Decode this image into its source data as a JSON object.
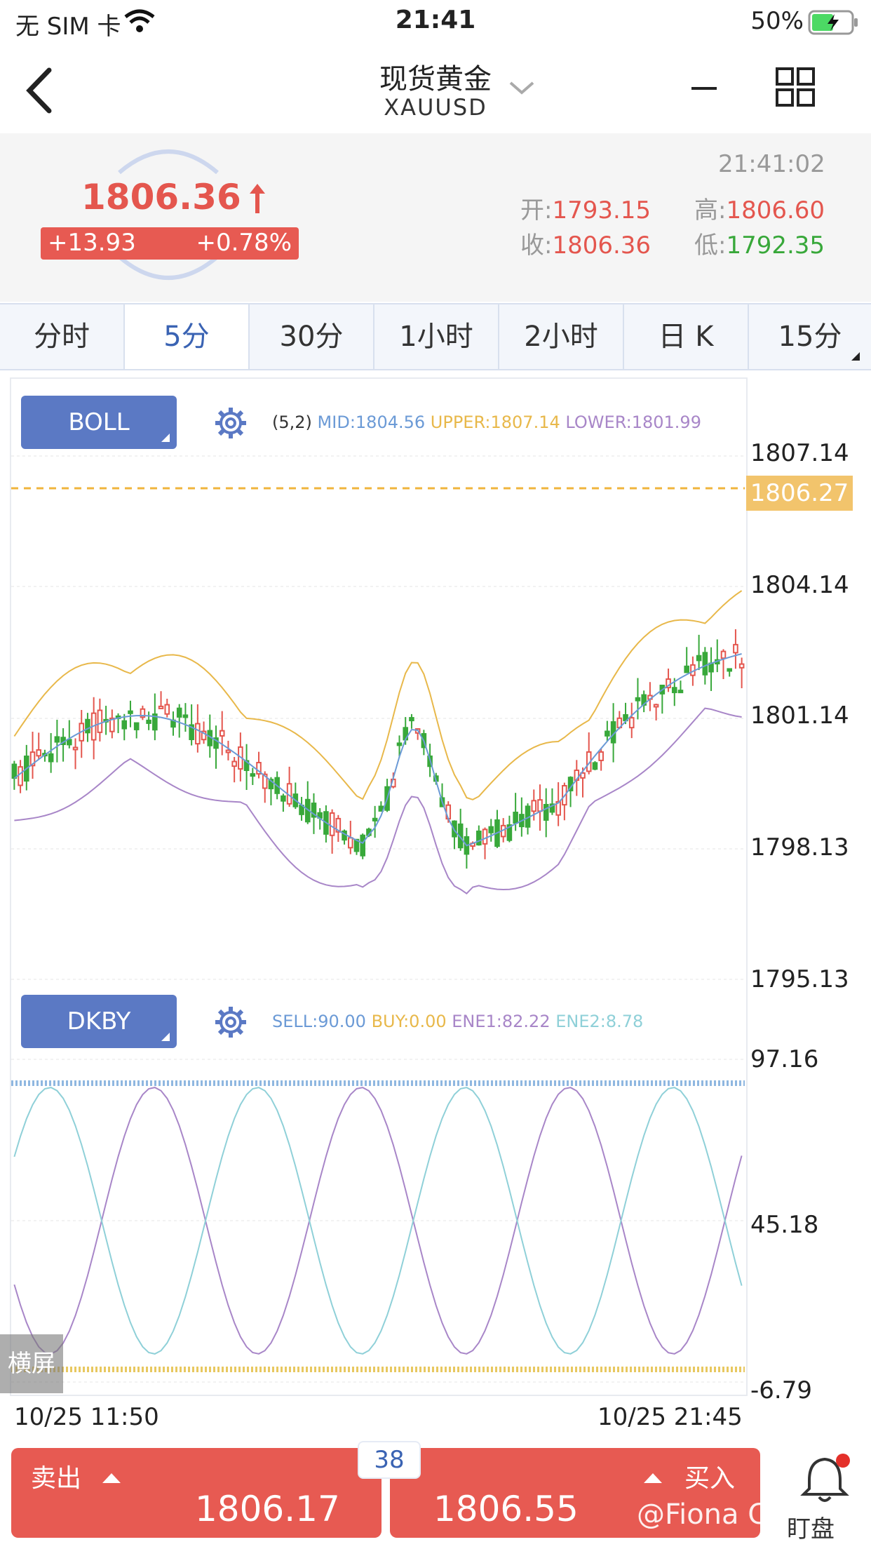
{
  "status": {
    "carrier": "无 SIM 卡",
    "time": "21:41",
    "battery": "50%"
  },
  "nav": {
    "title": "现货黄金",
    "symbol": "XAUUSD"
  },
  "quote": {
    "price": "1806.36",
    "change": "+13.93",
    "change_pct": "+0.78%",
    "timestamp": "21:41:02",
    "open_label": "开:",
    "open": "1793.15",
    "high_label": "高:",
    "high": "1806.60",
    "close_label": "收:",
    "close": "1806.36",
    "low_label": "低:",
    "low": "1792.35"
  },
  "tabs": [
    {
      "label": "分时"
    },
    {
      "label": "5分"
    },
    {
      "label": "30分"
    },
    {
      "label": "1小时"
    },
    {
      "label": "2小时"
    },
    {
      "label": "日 K"
    },
    {
      "label": "15分"
    }
  ],
  "boll": {
    "button": "BOLL",
    "params": "(5,2)",
    "mid": "MID:1804.56",
    "upper": "UPPER:1807.14",
    "lower": "LOWER:1801.99",
    "yticks": [
      "1807.14",
      "1804.14",
      "1801.14",
      "1798.13",
      "1795.13"
    ],
    "current": "1806.27"
  },
  "dkby": {
    "button": "DKBY",
    "sell": "SELL:90.00",
    "buy": "BUY:0.00",
    "ene1": "ENE1:82.22",
    "ene2": "ENE2:8.78",
    "yticks": [
      "97.16",
      "45.18",
      "-6.79"
    ]
  },
  "dates": {
    "start": "10/25 11:50",
    "end": "10/25 21:45"
  },
  "hscreen": "横屏",
  "trade": {
    "sell_label": "卖出",
    "sell_price": "1806.17",
    "buy_label": "买入",
    "buy_price": "1806.55",
    "spread": "38",
    "alert_label": "盯盘",
    "watermark": "@Fiona Chan"
  },
  "colors": {
    "up": "#e4564e",
    "down": "#38a83a",
    "accent": "#5b79c4",
    "upper": "#e8b84a",
    "lower": "#a886c8",
    "mid": "#6b9ad6"
  }
}
